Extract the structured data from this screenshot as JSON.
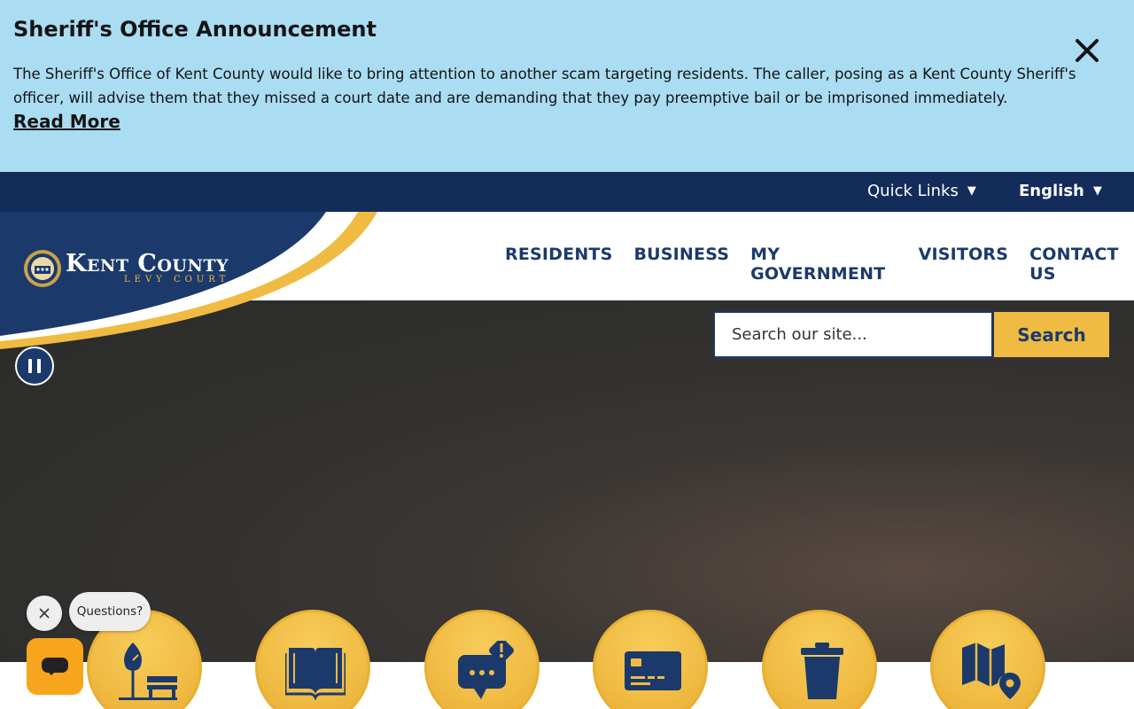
{
  "announcement": {
    "title": "Sheriff's Office Announcement",
    "body": "The Sheriff's Office of Kent County would like to bring attention to another scam targeting residents. The caller, posing as a Kent County Sheriff's officer, will advise them that they missed a court date and are demanding that they pay preemptive bail or be imprisoned immediately.",
    "link_label": "Read More",
    "close_icon": "close-icon"
  },
  "utility": {
    "quick_links": "Quick Links",
    "language": "English",
    "caret": "▼"
  },
  "logo": {
    "name": "Kent County",
    "sub": "LEVY COURT",
    "seal_icon": "county-seal-icon"
  },
  "nav": {
    "items": [
      {
        "label": "RESIDENTS"
      },
      {
        "label": "BUSINESS"
      },
      {
        "label": "MY GOVERNMENT"
      },
      {
        "label": "VISITORS"
      },
      {
        "label": "CONTACT US"
      }
    ]
  },
  "search": {
    "placeholder": "Search our site...",
    "button_label": "Search"
  },
  "hero": {
    "pause_icon": "pause-icon"
  },
  "quick_icons": [
    {
      "icon": "park-icon"
    },
    {
      "icon": "book-icon"
    },
    {
      "icon": "chat-alert-icon"
    },
    {
      "icon": "credit-card-icon"
    },
    {
      "icon": "trash-can-icon"
    },
    {
      "icon": "map-pin-icon"
    }
  ],
  "chat": {
    "bubble_text": "Questions?",
    "close_icon": "close-icon",
    "chat_icon": "chat-icon"
  },
  "colors": {
    "banner_bg": "#aadcf2",
    "navy": "#132c5a",
    "brand_blue": "#1b3a6b",
    "gold": "#f0bb43",
    "chat_orange": "#f7a51c"
  }
}
